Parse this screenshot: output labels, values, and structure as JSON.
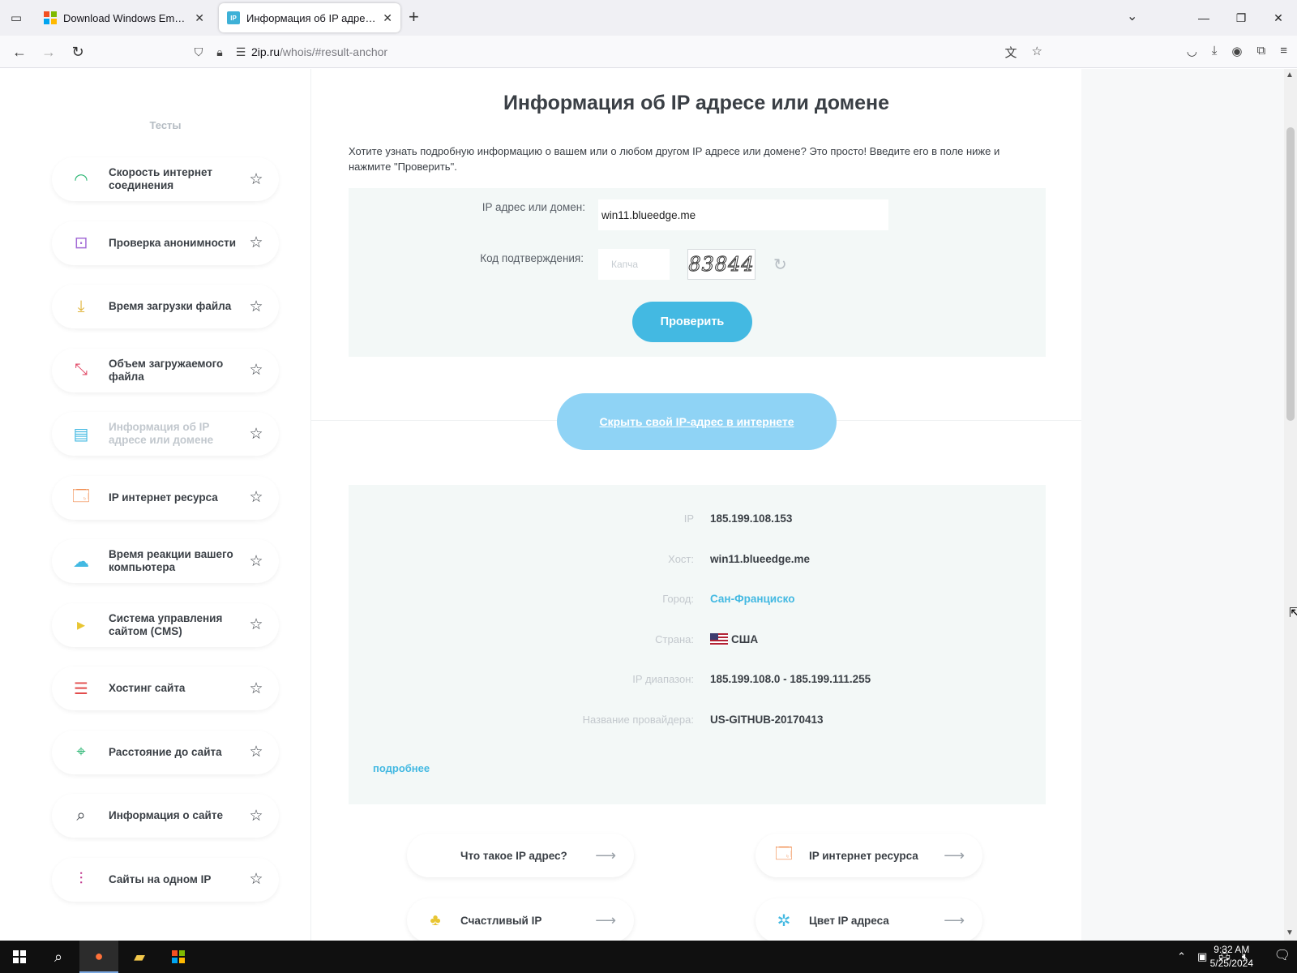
{
  "browser": {
    "tabs": [
      {
        "title": "Download Windows Embedded",
        "active": false
      },
      {
        "title": "Информация об IP адресе или",
        "active": true
      }
    ],
    "address": {
      "host": "2ip.ru",
      "path": "/whois/#result-anchor"
    }
  },
  "sidebar": {
    "title": "Тесты",
    "items": [
      {
        "label": "Скорость интернет соединения",
        "icon": "speedometer-icon",
        "color": "#2bb673"
      },
      {
        "label": "Проверка анонимности",
        "icon": "lock-window-icon",
        "color": "#a36bd6"
      },
      {
        "label": "Время загрузки файла",
        "icon": "download-icon",
        "color": "#e0b43a"
      },
      {
        "label": "Объем загружаемого файла",
        "icon": "resize-icon",
        "color": "#e24d6a"
      },
      {
        "label": "Информация об IP адресе или домене",
        "icon": "server-icon",
        "color": "#43b9e2",
        "current": true
      },
      {
        "label": "IP интернет ресурса",
        "icon": "browser-link-icon",
        "color": "#f08a4b"
      },
      {
        "label": "Время реакции вашего компьютера",
        "icon": "cloud-computer-icon",
        "color": "#43b9e2"
      },
      {
        "label": "Система управления сайтом (CMS)",
        "icon": "terminal-icon",
        "color": "#e8c532"
      },
      {
        "label": "Хостинг сайта",
        "icon": "hosting-icon",
        "color": "#e24d4d"
      },
      {
        "label": "Расстояние до сайта",
        "icon": "map-pin-icon",
        "color": "#2bb673"
      },
      {
        "label": "Информация о сайте",
        "icon": "site-search-icon",
        "color": "#3a3f45"
      },
      {
        "label": "Сайты на одном IP",
        "icon": "sitemap-icon",
        "color": "#c1368d"
      }
    ]
  },
  "main": {
    "title": "Информация об IP адресе или домене",
    "intro": "Хотите узнать подробную информацию о вашем или о любом другом IP адресе или домене? Это просто! Введите его в поле ниже и нажмите \"Проверить\".",
    "form": {
      "ip_label": "IP адрес или домен:",
      "ip_value": "win11.blueedge.me",
      "code_label": "Код подтверждения:",
      "code_placeholder": "Капча",
      "captcha_text": "83844",
      "submit": "Проверить"
    },
    "hide_ip": "Скрыть свой IP-адрес в интернете",
    "result": {
      "rows": [
        {
          "key": "IP",
          "value": "185.199.108.153"
        },
        {
          "key": "Хост:",
          "value": "win11.blueedge.me"
        },
        {
          "key": "Город:",
          "value": "Сан-Франциско"
        },
        {
          "key": "Страна:",
          "value": "США"
        },
        {
          "key": "IP диапазон:",
          "value": "185.199.108.0 - 185.199.111.255"
        },
        {
          "key": "Название провайдера:",
          "value": "US-GITHUB-20170413"
        }
      ],
      "more": "подробнее"
    },
    "cards": [
      {
        "label": "Что такое IP адрес?",
        "icon": ""
      },
      {
        "label": "IP интернет ресурса",
        "icon": "browser-link-icon"
      },
      {
        "label": "Счастливый IP",
        "icon": "clover-icon"
      },
      {
        "label": "Цвет IP адреса",
        "icon": "palette-icon"
      }
    ]
  },
  "taskbar": {
    "time": "9:32 AM",
    "date": "5/25/2024"
  },
  "colors": {
    "accent": "#43b9e2",
    "light_accent": "#8fd3f5",
    "panel_bg": "#f3f8f7",
    "text": "#3a3f45"
  }
}
